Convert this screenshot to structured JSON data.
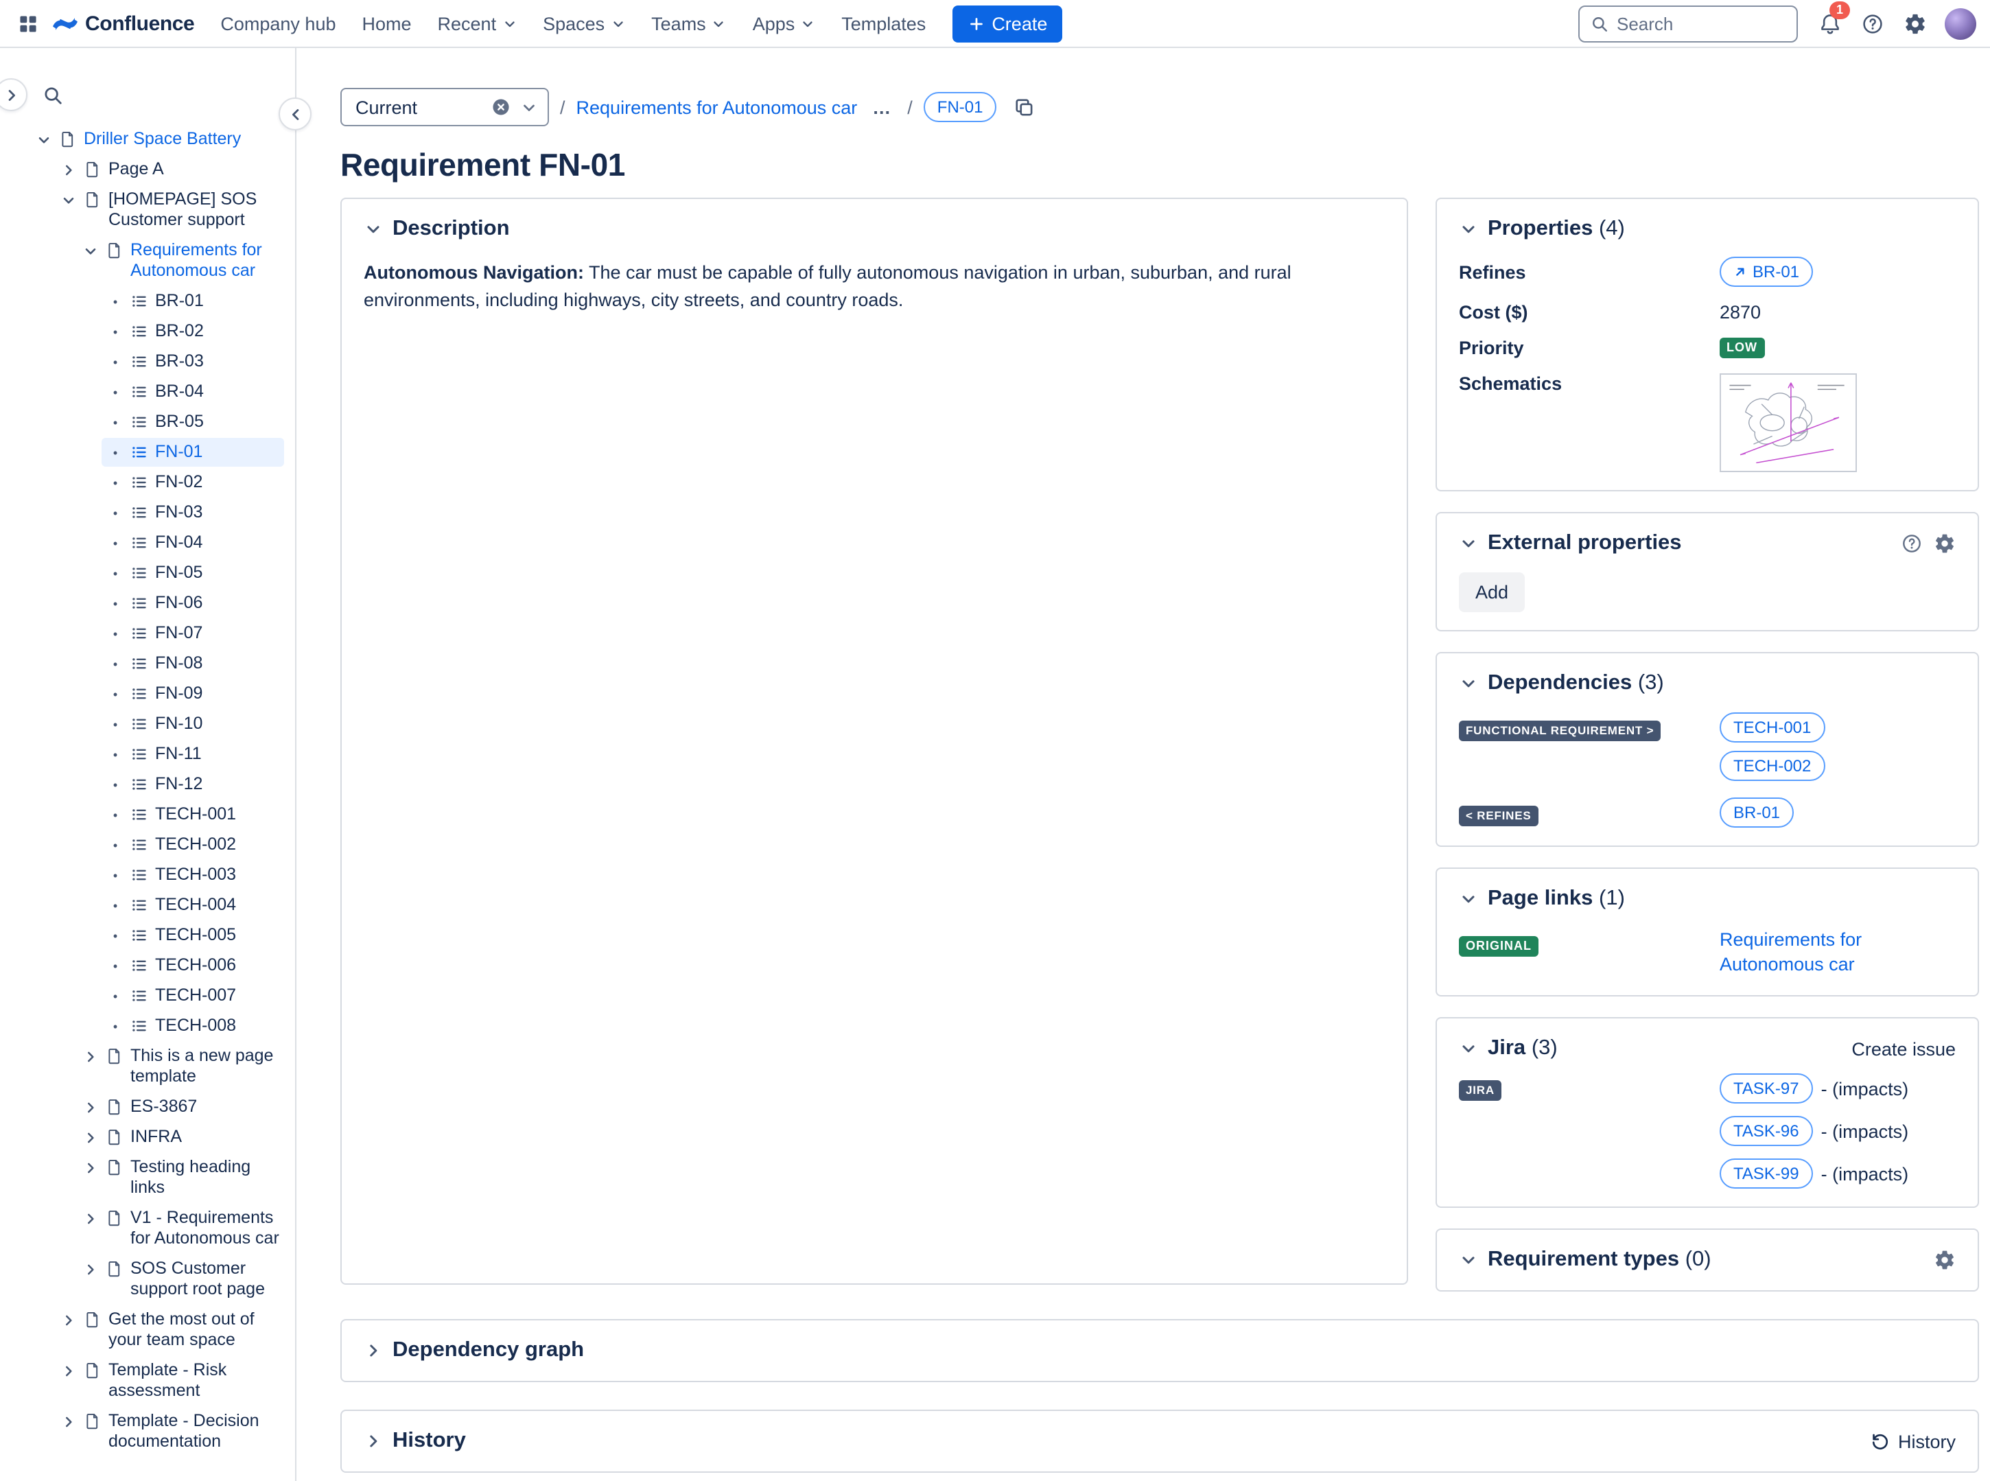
{
  "colors": {
    "accent_blue": "#0C66E4",
    "selected_row_bg": "#E9F2FF",
    "badge_dark": "#44546F",
    "badge_green": "#1F845A",
    "card_border": "#D5D9E0",
    "text_primary": "#172B4D",
    "text_secondary": "#626F86",
    "notification_red": "#F15B50",
    "chip_border": "#579DFF"
  },
  "icons": {
    "app_switcher": "grid",
    "search": "magnifier",
    "notifications": "bell",
    "help": "question-circle",
    "settings": "gear",
    "copy": "copy-pages",
    "clear_version": "x-circle",
    "refines_arrow": "arrow-up-right",
    "history": "undo-arrow",
    "tree_page": "document",
    "tree_requirement": "ordered-list"
  },
  "topnav": {
    "app_name": "Confluence",
    "items": [
      {
        "label": "Company hub",
        "dropdown": false
      },
      {
        "label": "Home",
        "dropdown": false
      },
      {
        "label": "Recent",
        "dropdown": true
      },
      {
        "label": "Spaces",
        "dropdown": true
      },
      {
        "label": "Teams",
        "dropdown": true
      },
      {
        "label": "Apps",
        "dropdown": true
      },
      {
        "label": "Templates",
        "dropdown": false
      }
    ],
    "create_label": "Create",
    "search_placeholder": "Search",
    "notification_count": "1"
  },
  "sidebar": {
    "tree": [
      {
        "label": "Driller Space Battery",
        "level": 0,
        "type": "page",
        "chev": "down",
        "accent": true
      },
      {
        "label": "Page A",
        "level": 1,
        "type": "page",
        "chev": "right"
      },
      {
        "label": "[HOMEPAGE] SOS Customer support",
        "level": 1,
        "type": "page",
        "chev": "down"
      },
      {
        "label": "Requirements for Autonomous car",
        "level": 2,
        "type": "page",
        "chev": "down",
        "accent": true
      },
      {
        "label": "BR-01",
        "level": 3,
        "type": "req"
      },
      {
        "label": "BR-02",
        "level": 3,
        "type": "req"
      },
      {
        "label": "BR-03",
        "level": 3,
        "type": "req"
      },
      {
        "label": "BR-04",
        "level": 3,
        "type": "req"
      },
      {
        "label": "BR-05",
        "level": 3,
        "type": "req"
      },
      {
        "label": "FN-01",
        "level": 3,
        "type": "req",
        "selected": true
      },
      {
        "label": "FN-02",
        "level": 3,
        "type": "req"
      },
      {
        "label": "FN-03",
        "level": 3,
        "type": "req"
      },
      {
        "label": "FN-04",
        "level": 3,
        "type": "req"
      },
      {
        "label": "FN-05",
        "level": 3,
        "type": "req"
      },
      {
        "label": "FN-06",
        "level": 3,
        "type": "req"
      },
      {
        "label": "FN-07",
        "level": 3,
        "type": "req"
      },
      {
        "label": "FN-08",
        "level": 3,
        "type": "req"
      },
      {
        "label": "FN-09",
        "level": 3,
        "type": "req"
      },
      {
        "label": "FN-10",
        "level": 3,
        "type": "req"
      },
      {
        "label": "FN-11",
        "level": 3,
        "type": "req"
      },
      {
        "label": "FN-12",
        "level": 3,
        "type": "req"
      },
      {
        "label": "TECH-001",
        "level": 3,
        "type": "req"
      },
      {
        "label": "TECH-002",
        "level": 3,
        "type": "req"
      },
      {
        "label": "TECH-003",
        "level": 3,
        "type": "req"
      },
      {
        "label": "TECH-004",
        "level": 3,
        "type": "req"
      },
      {
        "label": "TECH-005",
        "level": 3,
        "type": "req"
      },
      {
        "label": "TECH-006",
        "level": 3,
        "type": "req"
      },
      {
        "label": "TECH-007",
        "level": 3,
        "type": "req"
      },
      {
        "label": "TECH-008",
        "level": 3,
        "type": "req"
      },
      {
        "label": "This is a new page template",
        "level": 2,
        "type": "page",
        "chev": "right"
      },
      {
        "label": "ES-3867",
        "level": 2,
        "type": "page",
        "chev": "right"
      },
      {
        "label": "INFRA",
        "level": 2,
        "type": "page",
        "chev": "right"
      },
      {
        "label": "Testing heading links",
        "level": 2,
        "type": "page",
        "chev": "right"
      },
      {
        "label": "V1 - Requirements for Autonomous car",
        "level": 2,
        "type": "page",
        "chev": "right"
      },
      {
        "label": "SOS Customer support root page",
        "level": 2,
        "type": "page",
        "chev": "right"
      },
      {
        "label": "Get the most out of your team space",
        "level": 1,
        "type": "page",
        "chev": "right"
      },
      {
        "label": "Template - Risk assessment",
        "level": 1,
        "type": "page",
        "chev": "right"
      },
      {
        "label": "Template - Decision documentation",
        "level": 1,
        "type": "page",
        "chev": "right"
      }
    ]
  },
  "breadcrumb": {
    "version_label": "Current",
    "separator": "/",
    "parent_link": "Requirements for Autonomous car",
    "ellipsis": "…",
    "current_chip": "FN-01"
  },
  "page": {
    "title": "Requirement FN-01"
  },
  "description_panel": {
    "heading": "Description",
    "term": "Autonomous Navigation:",
    "body": "The car must be capable of fully autonomous navigation in urban, suburban, and rural environments, including highways, city streets, and country roads."
  },
  "properties_panel": {
    "heading": "Properties",
    "count": "(4)",
    "refines_label": "Refines",
    "refines_value": "BR-01",
    "cost_label": "Cost ($)",
    "cost_value": "2870",
    "priority_label": "Priority",
    "priority_value": "LOW",
    "schematics_label": "Schematics"
  },
  "external_properties_panel": {
    "heading": "External properties",
    "add_button": "Add"
  },
  "dependencies_panel": {
    "heading": "Dependencies",
    "count": "(3)",
    "outgoing_label": "FUNCTIONAL REQUIREMENT >",
    "outgoing_chips": [
      "TECH-001",
      "TECH-002"
    ],
    "incoming_label": "< REFINES",
    "incoming_chips": [
      "BR-01"
    ]
  },
  "page_links_panel": {
    "heading": "Page links",
    "count": "(1)",
    "badge": "ORIGINAL",
    "link": "Requirements for Autonomous car"
  },
  "jira_panel": {
    "heading": "Jira",
    "count": "(3)",
    "create_issue_label": "Create issue",
    "badge": "JIRA",
    "issues": [
      {
        "key": "TASK-97",
        "suffix": "- (impacts)"
      },
      {
        "key": "TASK-96",
        "suffix": "- (impacts)"
      },
      {
        "key": "TASK-99",
        "suffix": "- (impacts)"
      }
    ]
  },
  "requirement_types_panel": {
    "heading": "Requirement types",
    "count": "(0)"
  },
  "dependency_graph_panel": {
    "heading": "Dependency graph"
  },
  "history_panel": {
    "heading": "History",
    "history_button": "History"
  }
}
